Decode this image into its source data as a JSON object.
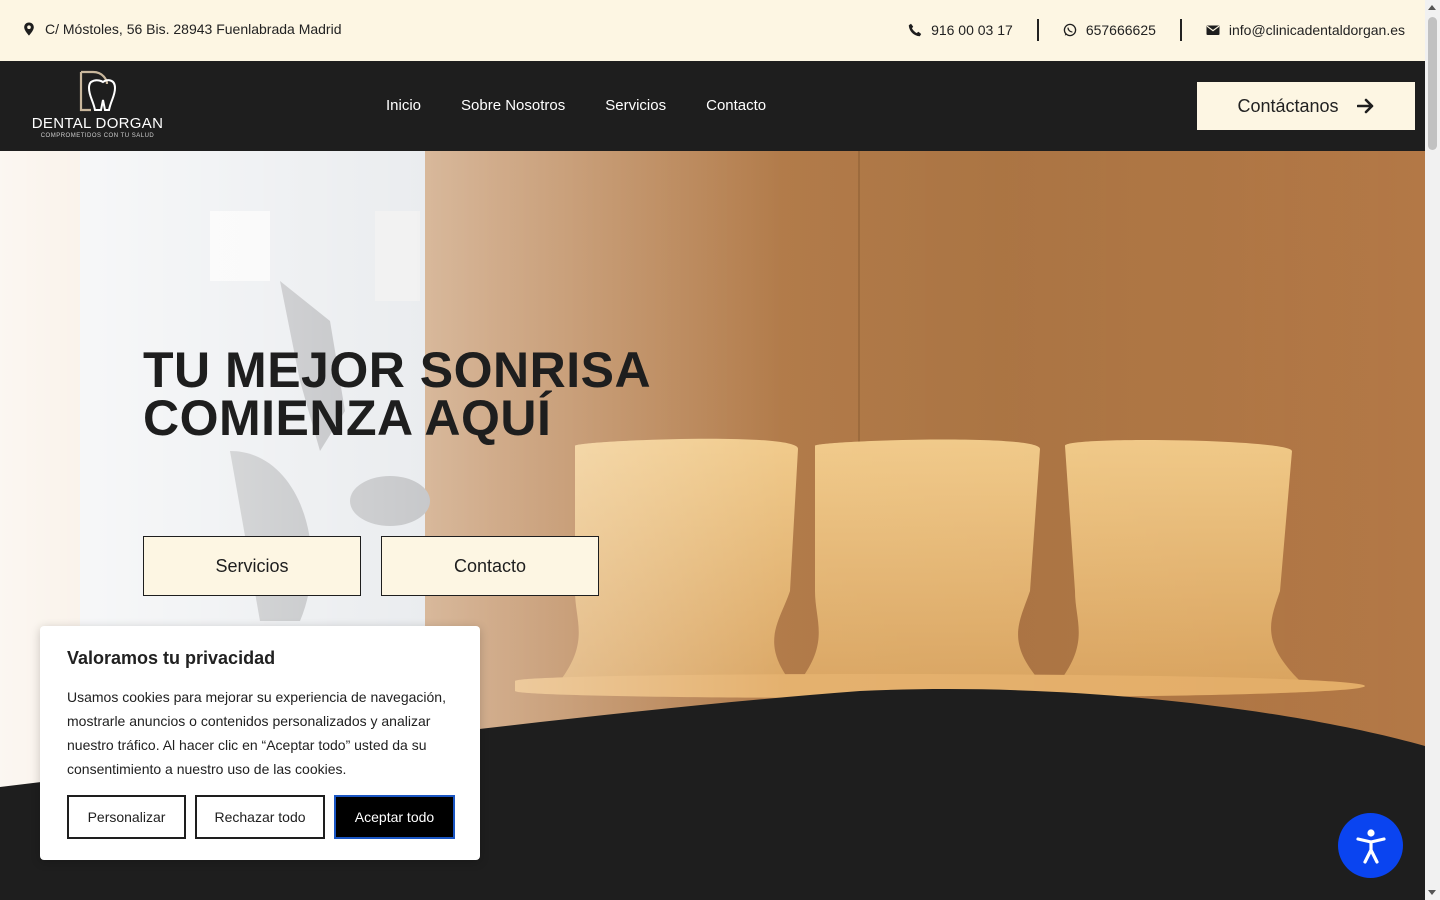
{
  "topbar": {
    "address": "C/ Móstoles, 56 Bis. 28943 Fuenlabrada Madrid",
    "phone": "916 00 03 17",
    "whatsapp": "657666625",
    "email": "info@clinicadentaldorgan.es"
  },
  "logo": {
    "name": "DENTAL DORGAN",
    "tagline": "COMPROMETIDOS CON TU SALUD"
  },
  "nav": {
    "items": [
      "Inicio",
      "Sobre Nosotros",
      "Servicios",
      "Contacto"
    ],
    "cta_label": "Contáctanos"
  },
  "hero": {
    "headline_line1": "TU MEJOR SONRISA",
    "headline_line2": "COMIENZA AQUÍ",
    "button_services": "Servicios",
    "button_contact": "Contacto"
  },
  "cookie_banner": {
    "title": "Valoramos tu privacidad",
    "text": "Usamos cookies para mejorar su experiencia de navegación, mostrarle anuncios o contenidos personalizados y analizar nuestro tráfico. Al hacer clic en “Aceptar todo” usted da su consentimiento a nuestro uso de las cookies.",
    "customize_label": "Personalizar",
    "reject_label": "Rechazar todo",
    "accept_label": "Aceptar todo"
  },
  "colors": {
    "cream": "#fdf6e3",
    "dark": "#1e1e1e",
    "accessibility_blue": "#0a44f0"
  },
  "icons": [
    "location-pin-icon",
    "phone-icon",
    "whatsapp-icon",
    "envelope-icon",
    "arrow-right-icon",
    "accessibility-icon"
  ]
}
